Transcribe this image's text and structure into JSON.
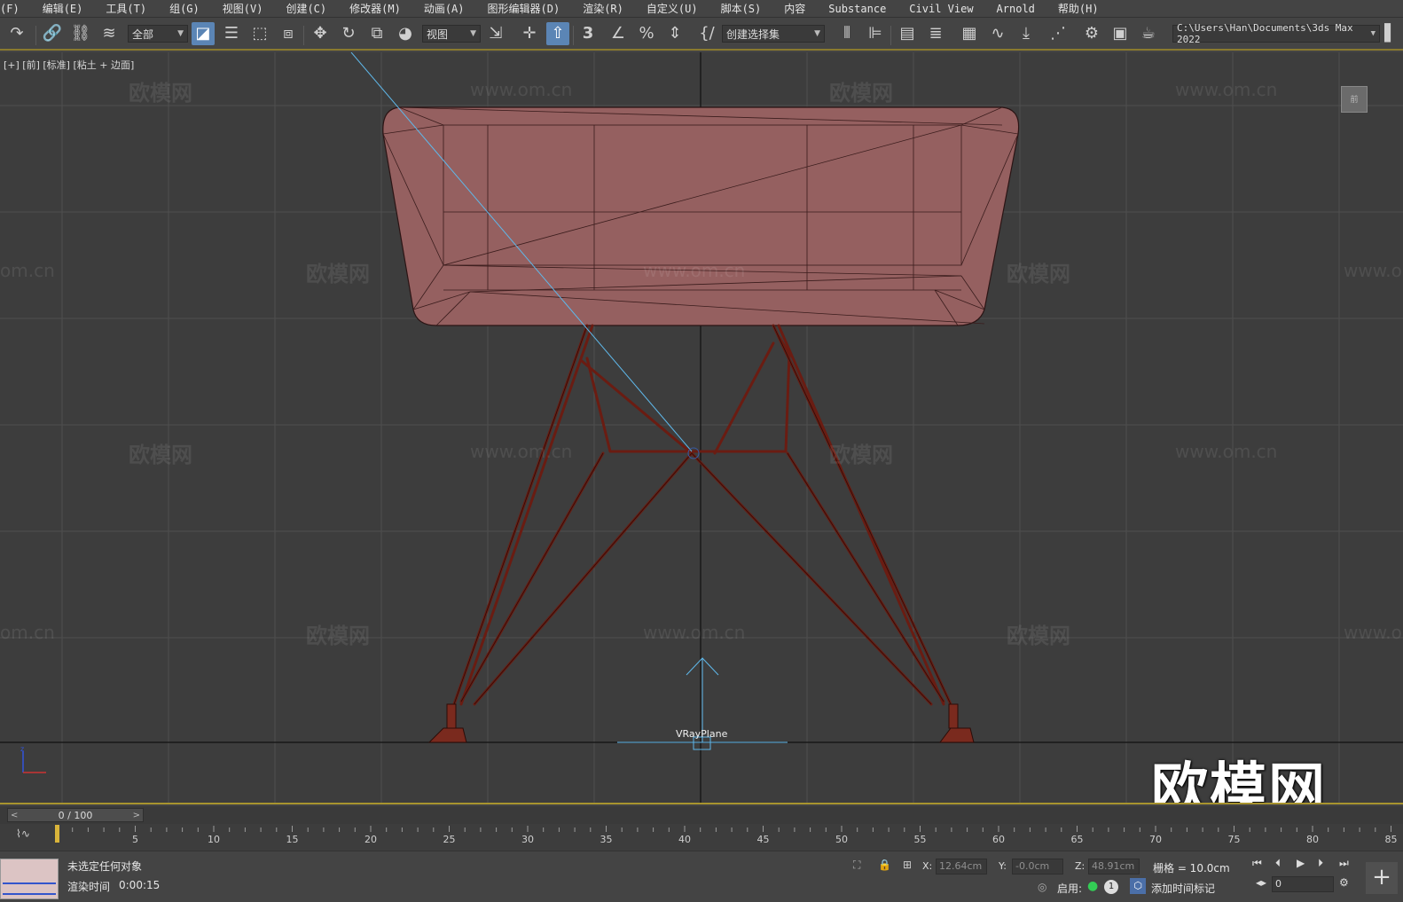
{
  "menu": [
    "(F)",
    "编辑(E)",
    "工具(T)",
    "组(G)",
    "视图(V)",
    "创建(C)",
    "修改器(M)",
    "动画(A)",
    "图形编辑器(D)",
    "渲染(R)",
    "自定义(U)",
    "脚本(S)",
    "内容",
    "Substance",
    "Civil View",
    "Arnold",
    "帮助(H)"
  ],
  "toolbar": {
    "selection_filter": "全部",
    "ref_coord": "视图",
    "named_selection": "创建选择集",
    "path": "C:\\Users\\Han\\Documents\\3ds Max 2022",
    "snap_label": "3"
  },
  "viewport": {
    "label": "[+] [前] [标准] [粘土 + 边面]",
    "vray_label": "VRayPlane",
    "viewcube_label": "前",
    "watermark_brand": "欧模网",
    "watermark_url": "www.om.cn",
    "watermark_url_partial": "om.cn",
    "big_watermark": "欧模网"
  },
  "timeline": {
    "frame_display": "0 / 100",
    "ticks": [
      "5",
      "10",
      "15",
      "20",
      "25",
      "30",
      "35",
      "40",
      "45",
      "50",
      "55",
      "60",
      "65",
      "70",
      "75",
      "80",
      "85"
    ]
  },
  "status": {
    "selection": "未选定任何对象",
    "render_time_label": "渲染时间",
    "render_time_value": "0:00:15",
    "x_label": "X:",
    "x_value": "12.64cm",
    "y_label": "Y:",
    "y_value": "-0.0cm",
    "z_label": "Z:",
    "z_value": "48.91cm",
    "grid_label": "栅格 = 10.0cm",
    "enable_label": "启用:",
    "add_time_tag": "添加时间标记",
    "frame_field": "0",
    "badge": "1"
  },
  "colors": {
    "seat_fill": "#956060",
    "frame_stroke": "#6a1c12",
    "highlight_line": "#5fb8ea",
    "accent_border": "#a8942e"
  }
}
